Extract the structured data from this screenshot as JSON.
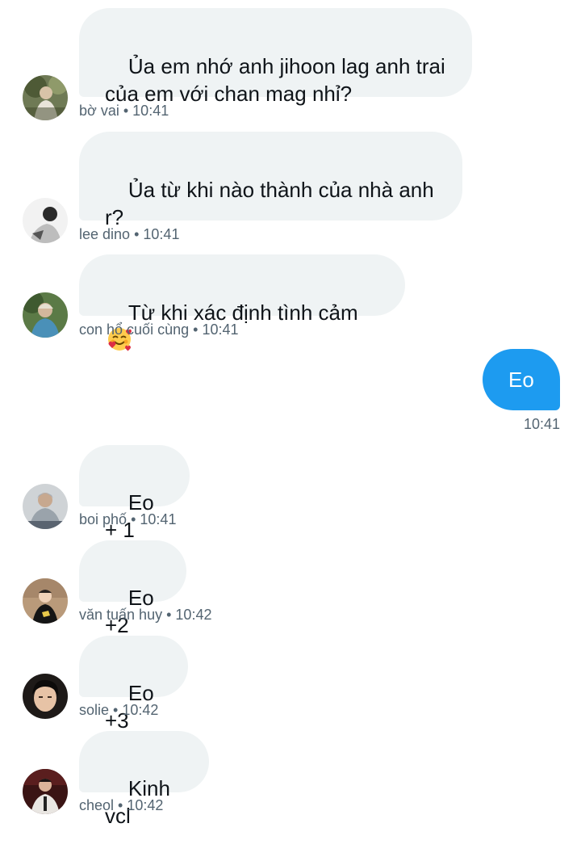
{
  "messages": [
    {
      "sender": "bờ vai",
      "time": "10:41",
      "text": "Ủa em nhớ anh jihoon lag anh trai\ncủa em với chan mag nhỉ?"
    },
    {
      "sender": "lee dino",
      "time": "10:41",
      "text": "Ủa từ khi nào thành của nhà anh\nr?"
    },
    {
      "sender": "con hổ cuối cùng",
      "time": "10:41",
      "text": "Từ khi xác định tình cảm",
      "emoji": "smiling-face-with-hearts"
    },
    {
      "outgoing": true,
      "time": "10:41",
      "text": "Eo"
    },
    {
      "sender": "boi phố",
      "time": "10:41",
      "text": "Eo + 1"
    },
    {
      "sender": "văn tuấn huy",
      "time": "10:42",
      "text": "Eo +2"
    },
    {
      "sender": "solie",
      "time": "10:42",
      "text": "Eo +3"
    },
    {
      "sender": "cheol",
      "time": "10:42",
      "text": "Kinh vcl"
    }
  ],
  "meta_separator": "•",
  "colors": {
    "incoming_bubble": "#eff3f4",
    "outgoing_bubble": "#1d9bf0",
    "meta_text": "#536471",
    "body_text": "#0f1419"
  }
}
